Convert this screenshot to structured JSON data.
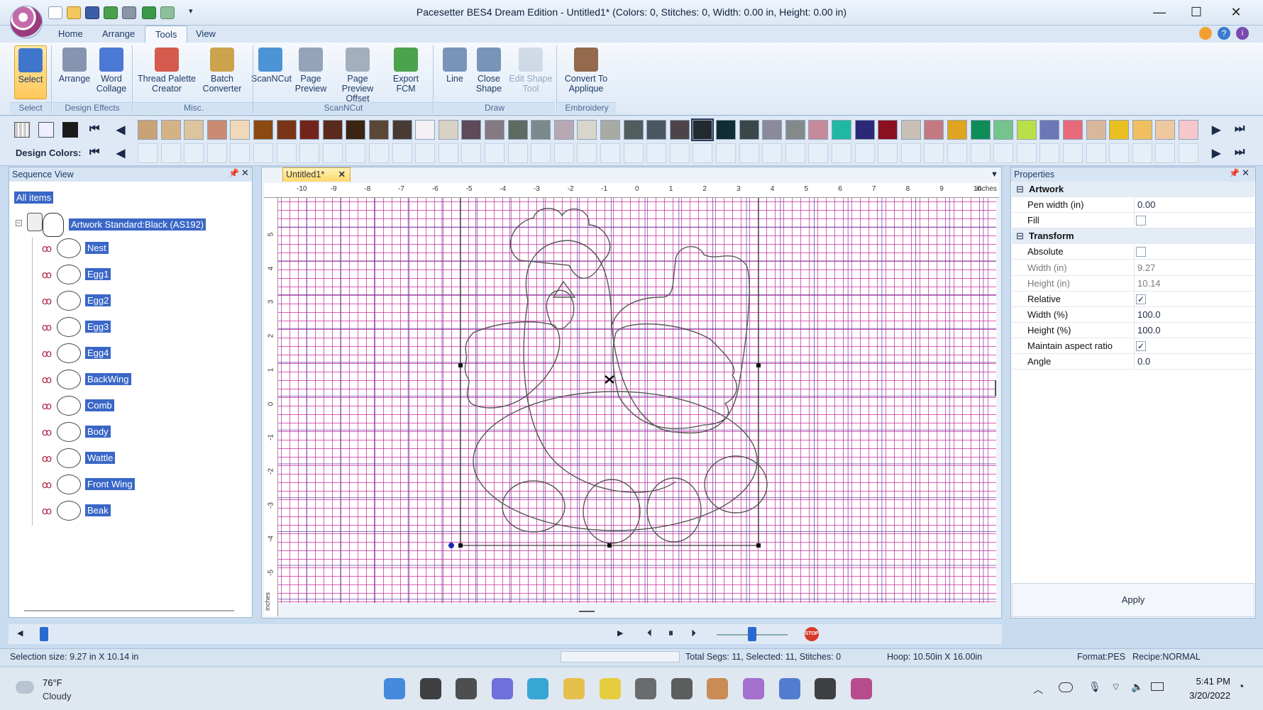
{
  "window": {
    "title": "Pacesetter BES4 Dream Edition - Untitled1* (Colors: 0, Stitches: 0, Width: 0.00 in, Height: 0.00 in)",
    "quick_access": [
      "new-icon",
      "open-icon",
      "save-icon",
      "export-icon",
      "print-icon",
      "undo-icon",
      "redo-icon"
    ],
    "controls": {
      "minimize": "—",
      "maximize": "☐",
      "close": "✕"
    }
  },
  "menu_tabs": [
    "Home",
    "Arrange",
    "Tools",
    "View"
  ],
  "active_tab": "Tools",
  "ribbon": {
    "buttons": [
      {
        "label": "Select",
        "group": "Select"
      },
      {
        "label": "Arrange",
        "group": "Design Effects"
      },
      {
        "label": "Word Collage",
        "group": "Design Effects"
      },
      {
        "label": "Thread Palette Creator",
        "group": "Misc."
      },
      {
        "label": "Batch Converter",
        "group": "Misc."
      },
      {
        "label": "ScanNCut",
        "group": "ScanNCut"
      },
      {
        "label": "Page Preview",
        "group": "ScanNCut"
      },
      {
        "label": "Page Preview Offset",
        "group": "ScanNCut"
      },
      {
        "label": "Export FCM",
        "group": "ScanNCut"
      },
      {
        "label": "Line",
        "group": "Draw"
      },
      {
        "label": "Close Shape",
        "group": "Draw"
      },
      {
        "label": "Edit Shape Tool",
        "group": "Draw"
      },
      {
        "label": "Convert To Applique",
        "group": "Embroidery"
      }
    ],
    "groups": [
      "Select",
      "Design Effects",
      "Misc.",
      "ScanNCut",
      "Draw",
      "Embroidery"
    ]
  },
  "palette": {
    "design_colors_label": "Design Colors:",
    "swatches": [
      "#c9a277",
      "#d4b286",
      "#dcc49c",
      "#c98a72",
      "#efd9b8",
      "#8a4a12",
      "#7a3416",
      "#72241c",
      "#5a2a1c",
      "#3c2412",
      "#5c4636",
      "#4a3a34",
      "#f2f0f4",
      "#d8d2c4",
      "#5e4a58",
      "#867a82",
      "#5e6a62",
      "#7c8a8e",
      "#b8a8b4",
      "#d8d6cc",
      "#a8aaa4",
      "#525c5c",
      "#4a5662",
      "#4c4448",
      "#222a30",
      "#102c34",
      "#3a4648",
      "#8a8a9a",
      "#848a8a",
      "#c48a9a",
      "#20b8a4",
      "#2c2878",
      "#8a1020",
      "#c8c0b4",
      "#c47880",
      "#e0a420",
      "#0e8c58",
      "#74c48c",
      "#b8e04a",
      "#6a78b8",
      "#e86a7a",
      "#d8b89c",
      "#e8c020",
      "#f0c060",
      "#f0c8a0",
      "#f6c8cc"
    ]
  },
  "sequence_view": {
    "title": "Sequence View",
    "all_items": "All items",
    "root": "Artwork Standard:Black (AS192)",
    "items": [
      "Nest",
      "Egg1",
      "Egg2",
      "Egg3",
      "Egg4",
      "BackWing",
      "Comb",
      "Body",
      "Wattle",
      "Front Wing",
      "Beak"
    ]
  },
  "document": {
    "tab": "Untitled1*",
    "ruler_unit": "inches",
    "top_ticks": [
      "-10",
      "-9",
      "-8",
      "-7",
      "-6",
      "-5",
      "-4",
      "-3",
      "-2",
      "-1",
      "0",
      "1",
      "2",
      "3",
      "4",
      "5",
      "6",
      "7",
      "8",
      "9",
      "10"
    ],
    "left_ticks": [
      "5",
      "4",
      "3",
      "2",
      "1",
      "0",
      "-1",
      "-2",
      "-3",
      "-4",
      "-5"
    ]
  },
  "properties": {
    "title": "Properties",
    "rows": [
      {
        "type": "section",
        "label": "Artwork"
      },
      {
        "label": "Pen width (in)",
        "value": "0.00"
      },
      {
        "label": "Fill",
        "check": false
      },
      {
        "type": "section",
        "label": "Transform"
      },
      {
        "label": "Absolute",
        "check": false
      },
      {
        "label": "Width (in)",
        "value": "9.27",
        "dim": true
      },
      {
        "label": "Height (in)",
        "value": "10.14",
        "dim": true
      },
      {
        "label": "Relative",
        "check": true
      },
      {
        "label": "Width (%)",
        "value": "100.0"
      },
      {
        "label": "Height (%)",
        "value": "100.0"
      },
      {
        "label": "Maintain aspect ratio",
        "check": true
      },
      {
        "label": "Angle",
        "value": "0.0"
      }
    ],
    "apply": "Apply"
  },
  "status": {
    "selection": "Selection size: 9.27 in X 10.14 in",
    "segs": "Total Segs: 11, Selected: 11, Stitches: 0",
    "hoop": "Hoop: 10.50in X 16.00in",
    "format": "Format:PES",
    "recipe": "Recipe:NORMAL"
  },
  "taskbar": {
    "weather_temp": "76°F",
    "weather_desc": "Cloudy",
    "time": "5:41 PM",
    "date": "3/20/2022",
    "apps": [
      "windows-start-icon",
      "search-icon",
      "file-explorer-taskview-icon",
      "chat-icon",
      "edge-icon",
      "folder-icon",
      "notes-icon",
      "calculator-icon",
      "game-icon",
      "photos-icon",
      "snip-icon",
      "notepad-icon",
      "terminal-icon",
      "bes4-app-icon"
    ]
  }
}
